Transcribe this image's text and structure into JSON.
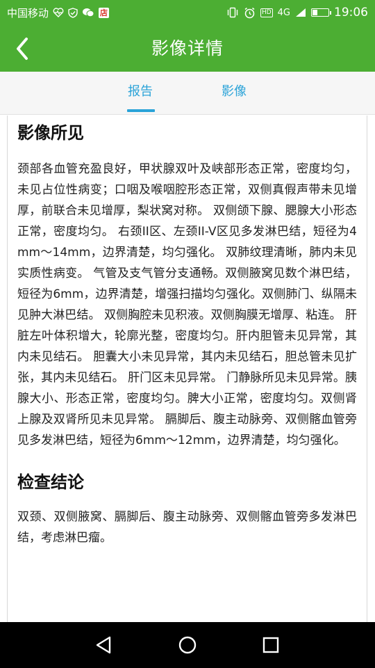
{
  "status_bar": {
    "carrier": "中国移动",
    "store_badge": "店",
    "hd": "HD",
    "network": "4G",
    "time": "19:06",
    "battery_level": 0.35,
    "icons": [
      "heartbeat-icon",
      "shield-icon",
      "wechat-icon",
      "store-icon",
      "vibrate-icon",
      "alarm-icon",
      "hd-icon",
      "signal-icon",
      "battery-icon"
    ]
  },
  "app_bar": {
    "title": "影像详情",
    "back_icon": "chevron-left-icon"
  },
  "tabs": [
    {
      "label": "报告",
      "active": true
    },
    {
      "label": "影像",
      "active": false
    }
  ],
  "report": {
    "findings_title": "影像所见",
    "findings_text": "颈部各血管充盈良好，甲状腺双叶及峡部形态正常，密度均匀，未见占位性病变；口咽及喉咽腔形态正常，双侧真假声带未见增厚，前联合未见增厚，梨状窝对称。 双侧颌下腺、腮腺大小形态正常，密度均匀。 右颈II区、左颈II-V区见多发淋巴结，短径为4mm～14mm，边界清楚，均匀强化。 双肺纹理清晰，肺内未见实质性病变。 气管及支气管分支通畅。双侧腋窝见数个淋巴结，短径为6mm，边界清楚，增强扫描均匀强化。双侧肺门、纵隔未见肿大淋巴结。 双侧胸腔未见积液。双侧胸膜无增厚、粘连。 肝脏左叶体积增大，轮廓光整，密度均匀。肝内胆管未见异常，其内未见结石。 胆囊大小未见异常，其内未见结石，胆总管未见扩张，其内未见结石。 肝门区未见异常。 门静脉所见未见异常。胰腺大小、形态正常，密度均匀。脾大小正常，密度均匀。双侧肾上腺及双肾所见未见异常。 膈脚后、腹主动脉旁、双侧髂血管旁见多发淋巴结，短径为6mm～12mm，边界清楚，均匀强化。",
    "conclusion_title": "检查结论",
    "conclusion_text": "双颈、双侧腋窝、膈脚后、腹主动脉旁、双侧髂血管旁多发淋巴结，考虑淋巴瘤。"
  },
  "nav_bar": {
    "icons": [
      "back-triangle-icon",
      "home-circle-icon",
      "recents-square-icon"
    ]
  },
  "colors": {
    "primary_green": "#4cae33",
    "tab_blue": "#2aa3d8"
  }
}
